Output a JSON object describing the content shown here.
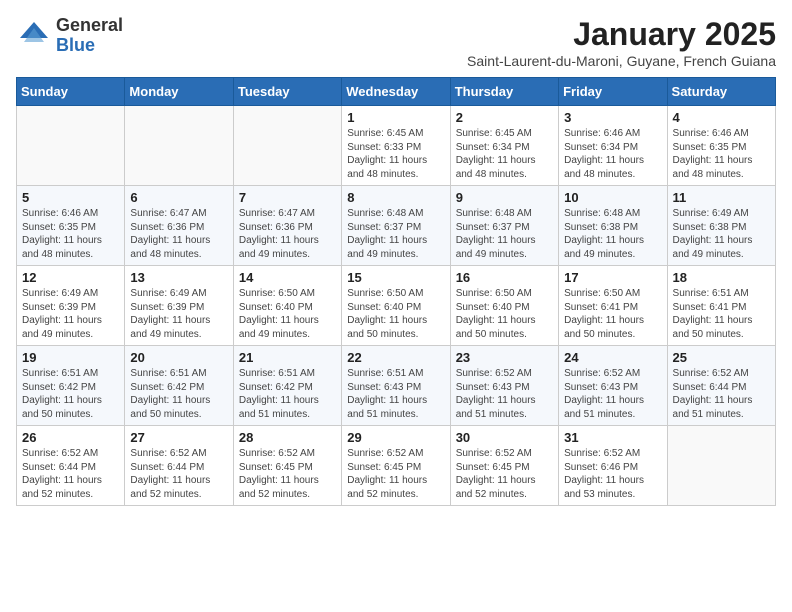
{
  "header": {
    "logo_general": "General",
    "logo_blue": "Blue",
    "month_title": "January 2025",
    "location": "Saint-Laurent-du-Maroni, Guyane, French Guiana"
  },
  "days_of_week": [
    "Sunday",
    "Monday",
    "Tuesday",
    "Wednesday",
    "Thursday",
    "Friday",
    "Saturday"
  ],
  "weeks": [
    [
      {
        "day": "",
        "info": ""
      },
      {
        "day": "",
        "info": ""
      },
      {
        "day": "",
        "info": ""
      },
      {
        "day": "1",
        "info": "Sunrise: 6:45 AM\nSunset: 6:33 PM\nDaylight: 11 hours and 48 minutes."
      },
      {
        "day": "2",
        "info": "Sunrise: 6:45 AM\nSunset: 6:34 PM\nDaylight: 11 hours and 48 minutes."
      },
      {
        "day": "3",
        "info": "Sunrise: 6:46 AM\nSunset: 6:34 PM\nDaylight: 11 hours and 48 minutes."
      },
      {
        "day": "4",
        "info": "Sunrise: 6:46 AM\nSunset: 6:35 PM\nDaylight: 11 hours and 48 minutes."
      }
    ],
    [
      {
        "day": "5",
        "info": "Sunrise: 6:46 AM\nSunset: 6:35 PM\nDaylight: 11 hours and 48 minutes."
      },
      {
        "day": "6",
        "info": "Sunrise: 6:47 AM\nSunset: 6:36 PM\nDaylight: 11 hours and 48 minutes."
      },
      {
        "day": "7",
        "info": "Sunrise: 6:47 AM\nSunset: 6:36 PM\nDaylight: 11 hours and 49 minutes."
      },
      {
        "day": "8",
        "info": "Sunrise: 6:48 AM\nSunset: 6:37 PM\nDaylight: 11 hours and 49 minutes."
      },
      {
        "day": "9",
        "info": "Sunrise: 6:48 AM\nSunset: 6:37 PM\nDaylight: 11 hours and 49 minutes."
      },
      {
        "day": "10",
        "info": "Sunrise: 6:48 AM\nSunset: 6:38 PM\nDaylight: 11 hours and 49 minutes."
      },
      {
        "day": "11",
        "info": "Sunrise: 6:49 AM\nSunset: 6:38 PM\nDaylight: 11 hours and 49 minutes."
      }
    ],
    [
      {
        "day": "12",
        "info": "Sunrise: 6:49 AM\nSunset: 6:39 PM\nDaylight: 11 hours and 49 minutes."
      },
      {
        "day": "13",
        "info": "Sunrise: 6:49 AM\nSunset: 6:39 PM\nDaylight: 11 hours and 49 minutes."
      },
      {
        "day": "14",
        "info": "Sunrise: 6:50 AM\nSunset: 6:40 PM\nDaylight: 11 hours and 49 minutes."
      },
      {
        "day": "15",
        "info": "Sunrise: 6:50 AM\nSunset: 6:40 PM\nDaylight: 11 hours and 50 minutes."
      },
      {
        "day": "16",
        "info": "Sunrise: 6:50 AM\nSunset: 6:40 PM\nDaylight: 11 hours and 50 minutes."
      },
      {
        "day": "17",
        "info": "Sunrise: 6:50 AM\nSunset: 6:41 PM\nDaylight: 11 hours and 50 minutes."
      },
      {
        "day": "18",
        "info": "Sunrise: 6:51 AM\nSunset: 6:41 PM\nDaylight: 11 hours and 50 minutes."
      }
    ],
    [
      {
        "day": "19",
        "info": "Sunrise: 6:51 AM\nSunset: 6:42 PM\nDaylight: 11 hours and 50 minutes."
      },
      {
        "day": "20",
        "info": "Sunrise: 6:51 AM\nSunset: 6:42 PM\nDaylight: 11 hours and 50 minutes."
      },
      {
        "day": "21",
        "info": "Sunrise: 6:51 AM\nSunset: 6:42 PM\nDaylight: 11 hours and 51 minutes."
      },
      {
        "day": "22",
        "info": "Sunrise: 6:51 AM\nSunset: 6:43 PM\nDaylight: 11 hours and 51 minutes."
      },
      {
        "day": "23",
        "info": "Sunrise: 6:52 AM\nSunset: 6:43 PM\nDaylight: 11 hours and 51 minutes."
      },
      {
        "day": "24",
        "info": "Sunrise: 6:52 AM\nSunset: 6:43 PM\nDaylight: 11 hours and 51 minutes."
      },
      {
        "day": "25",
        "info": "Sunrise: 6:52 AM\nSunset: 6:44 PM\nDaylight: 11 hours and 51 minutes."
      }
    ],
    [
      {
        "day": "26",
        "info": "Sunrise: 6:52 AM\nSunset: 6:44 PM\nDaylight: 11 hours and 52 minutes."
      },
      {
        "day": "27",
        "info": "Sunrise: 6:52 AM\nSunset: 6:44 PM\nDaylight: 11 hours and 52 minutes."
      },
      {
        "day": "28",
        "info": "Sunrise: 6:52 AM\nSunset: 6:45 PM\nDaylight: 11 hours and 52 minutes."
      },
      {
        "day": "29",
        "info": "Sunrise: 6:52 AM\nSunset: 6:45 PM\nDaylight: 11 hours and 52 minutes."
      },
      {
        "day": "30",
        "info": "Sunrise: 6:52 AM\nSunset: 6:45 PM\nDaylight: 11 hours and 52 minutes."
      },
      {
        "day": "31",
        "info": "Sunrise: 6:52 AM\nSunset: 6:46 PM\nDaylight: 11 hours and 53 minutes."
      },
      {
        "day": "",
        "info": ""
      }
    ]
  ]
}
